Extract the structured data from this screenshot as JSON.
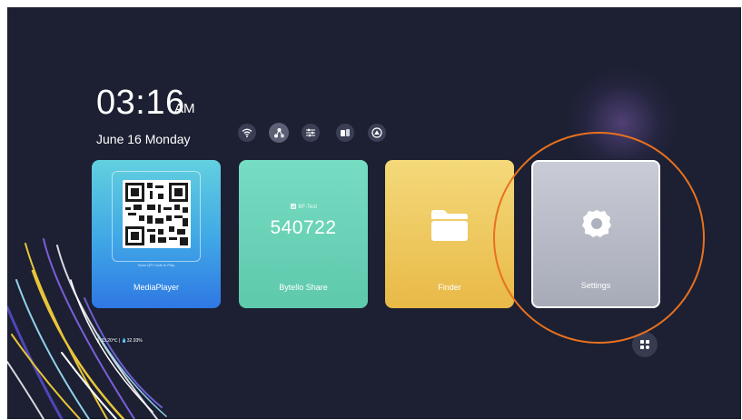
{
  "clock": {
    "time": "03:16",
    "ampm": "AM",
    "date": "June 16  Monday"
  },
  "quick_icons": [
    {
      "name": "wifi-icon",
      "active": false
    },
    {
      "name": "share-icon",
      "active": true
    },
    {
      "name": "sliders-icon",
      "active": false
    },
    {
      "name": "dual-screen-icon",
      "active": false
    },
    {
      "name": "triangle-app-icon",
      "active": false
    }
  ],
  "cards": {
    "media": {
      "label": "MediaPlayer",
      "qr_hint": "Scan QR Code to Play"
    },
    "share": {
      "label": "Bytello Share",
      "wifi_name": "BF-Test",
      "code": "540722"
    },
    "finder": {
      "label": "Finder"
    },
    "settings": {
      "label": "Settings"
    }
  },
  "status": {
    "text": "🌡33.20℃ | 💧32.93%"
  },
  "colors": {
    "background": "#1c2032",
    "highlight": "#e8711f"
  }
}
